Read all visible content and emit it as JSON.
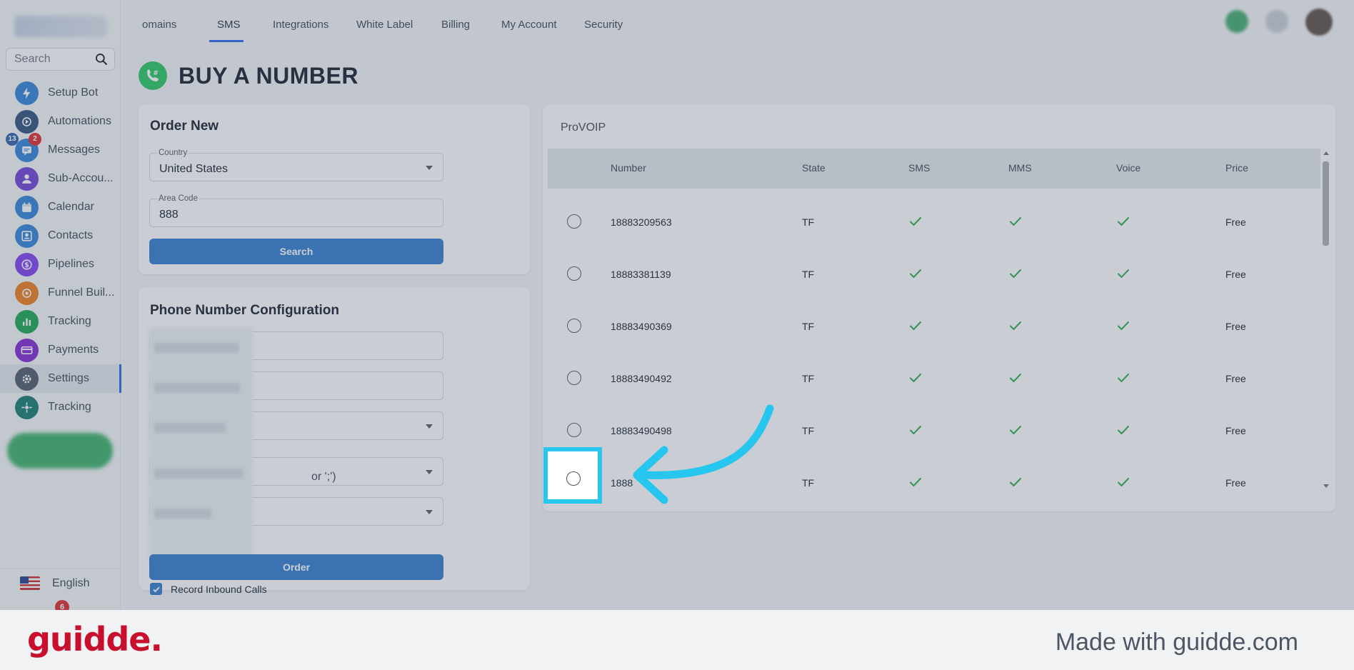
{
  "sidebar": {
    "search_placeholder": "Search",
    "items": [
      {
        "label": "Setup Bot",
        "icon": "lightning-icon",
        "color": "#2b7fd6"
      },
      {
        "label": "Automations",
        "icon": "automation-icon",
        "color": "#2b4a7a"
      },
      {
        "label": "Messages",
        "icon": "messages-icon",
        "color": "#2b7fd6",
        "badges": [
          "13",
          "2"
        ]
      },
      {
        "label": "Sub-Accou...",
        "icon": "user-icon",
        "color": "#6d3bd1"
      },
      {
        "label": "Calendar",
        "icon": "calendar-icon",
        "color": "#2b7fd6"
      },
      {
        "label": "Contacts",
        "icon": "contacts-icon",
        "color": "#2b7fd6"
      },
      {
        "label": "Pipelines",
        "icon": "dollar-icon",
        "color": "#7c3aed"
      },
      {
        "label": "Funnel Buil...",
        "icon": "funnel-icon",
        "color": "#ea7a16"
      },
      {
        "label": "Tracking",
        "icon": "bar-chart-icon",
        "color": "#16a34a"
      },
      {
        "label": "Payments",
        "icon": "card-icon",
        "color": "#7e22ce"
      },
      {
        "label": "Settings",
        "icon": "gear-icon",
        "color": "#4b5563"
      },
      {
        "label": "Tracking",
        "icon": "crosshair-icon",
        "color": "#0f766e"
      }
    ],
    "language": "English",
    "bottom_badge": "6"
  },
  "tabs": [
    "omains",
    "SMS",
    "Integrations",
    "White Label",
    "Billing",
    "My Account",
    "Security"
  ],
  "active_tab": "SMS",
  "page": {
    "title": "BUY A NUMBER"
  },
  "order_new": {
    "title": "Order New",
    "country_label": "Country",
    "country_value": "United States",
    "area_code_label": "Area Code",
    "area_code_value": "888",
    "search_button": "Search"
  },
  "config": {
    "title": "Phone Number Configuration",
    "partial_text": "or ';')",
    "record_inbound": "Record Inbound Calls",
    "order_button": "Order"
  },
  "provider": {
    "name": "ProVOIP",
    "columns": [
      "Number",
      "State",
      "SMS",
      "MMS",
      "Voice",
      "Price"
    ],
    "rows": [
      {
        "number": "18883209563",
        "state": "TF",
        "price": "Free"
      },
      {
        "number": "18883381139",
        "state": "TF",
        "price": "Free"
      },
      {
        "number": "18883490369",
        "state": "TF",
        "price": "Free"
      },
      {
        "number": "18883490492",
        "state": "TF",
        "price": "Free"
      },
      {
        "number": "18883490498",
        "state": "TF",
        "price": "Free"
      },
      {
        "number": "1888",
        "state": "TF",
        "price": "Free"
      }
    ]
  },
  "footer": {
    "brand": "guidde.",
    "made_with": "Made with guidde.com"
  },
  "colors": {
    "accent": "#2b78cd",
    "highlight": "#27c6ee",
    "check": "#22a845",
    "brand": "#c8102e"
  }
}
